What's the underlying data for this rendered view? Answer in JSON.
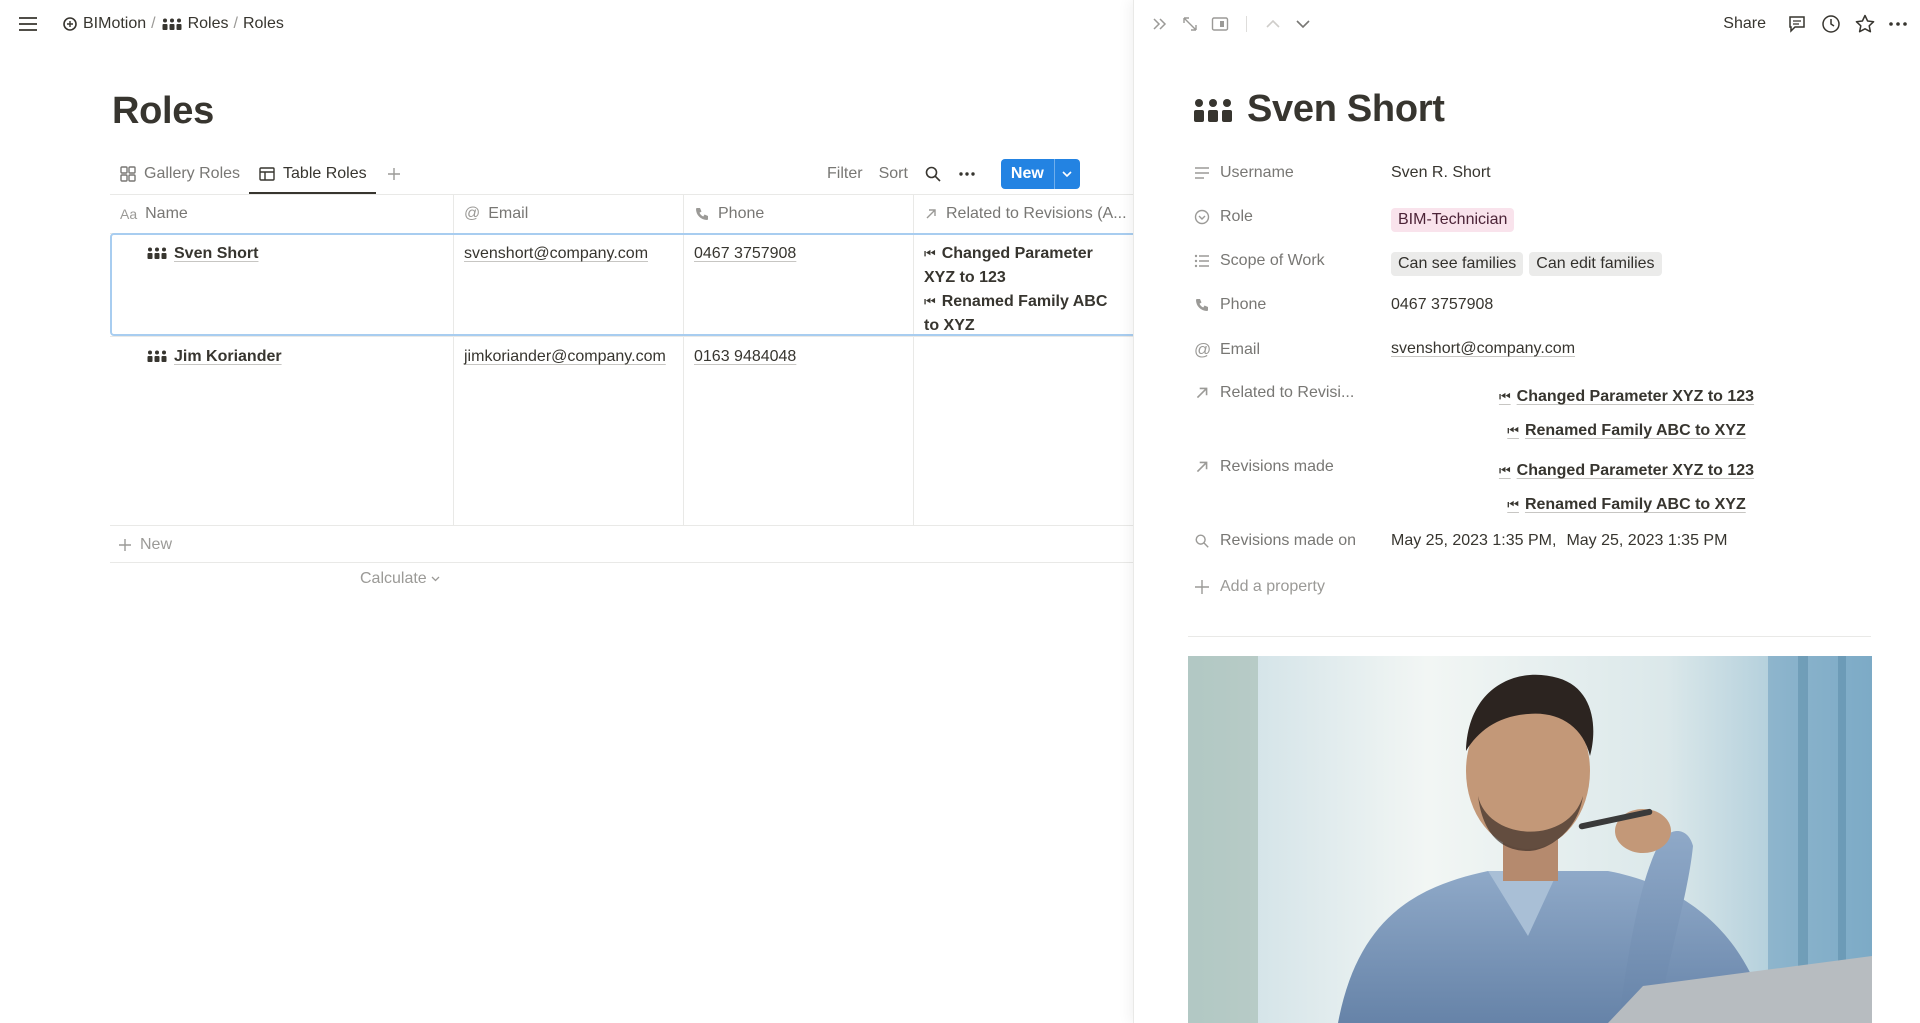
{
  "breadcrumb": {
    "workspace": "BIMotion",
    "sep1": "/",
    "parent": "Roles",
    "sep2": "/",
    "current": "Roles"
  },
  "page": {
    "title": "Roles"
  },
  "views": {
    "tabs": [
      {
        "label": "Gallery Roles",
        "icon": "gallery-icon",
        "active": false
      },
      {
        "label": "Table Roles",
        "icon": "table-icon",
        "active": true
      }
    ],
    "filter_label": "Filter",
    "sort_label": "Sort",
    "new_label": "New"
  },
  "table": {
    "columns": [
      {
        "label": "Name",
        "icon": "Aa"
      },
      {
        "label": "Email",
        "icon": "@"
      },
      {
        "label": "Phone",
        "icon": "phone-icon"
      },
      {
        "label": "Related to Revisions (A...",
        "icon": "arrow-up-right-icon"
      }
    ],
    "rows": [
      {
        "name": "Sven Short",
        "email": "svenshort@company.com",
        "phone": "0467 3757908",
        "related": [
          "Changed Parameter XYZ to 123",
          "Renamed Family ABC to XYZ"
        ]
      },
      {
        "name": "Jim Koriander",
        "email": "jimkoriander@company.com",
        "phone": "0163 9484048",
        "related": []
      }
    ],
    "new_row_label": "New",
    "calculate_label": "Calculate"
  },
  "related_glyph": "⏮",
  "panel": {
    "share_label": "Share",
    "title": "Sven Short",
    "properties": {
      "username": {
        "label": "Username",
        "value": "Sven R. Short"
      },
      "role": {
        "label": "Role",
        "value": "BIM-Technician",
        "color": "#f9e3ec"
      },
      "scope": {
        "label": "Scope of Work",
        "values": [
          "Can see families",
          "Can edit families"
        ]
      },
      "phone": {
        "label": "Phone",
        "value": "0467 3757908"
      },
      "email": {
        "label": "Email",
        "value": "svenshort@company.com"
      },
      "related": {
        "label": "Related to Revisi...",
        "values": [
          "Changed Parameter XYZ to 123",
          "Renamed Family ABC to XYZ"
        ]
      },
      "revisions": {
        "label": "Revisions made",
        "values": [
          "Changed Parameter XYZ to 123",
          "Renamed Family ABC to XYZ"
        ]
      },
      "revisions_on": {
        "label": "Revisions made on",
        "values": [
          "May 25, 2023 1:35 PM",
          "May 25, 2023 1:35 PM"
        ]
      }
    },
    "add_property_label": "Add a property"
  },
  "colors": {
    "accent": "#2383e2",
    "selection": "#a8cdf0",
    "text": "#37352f",
    "muted": "#787774"
  }
}
